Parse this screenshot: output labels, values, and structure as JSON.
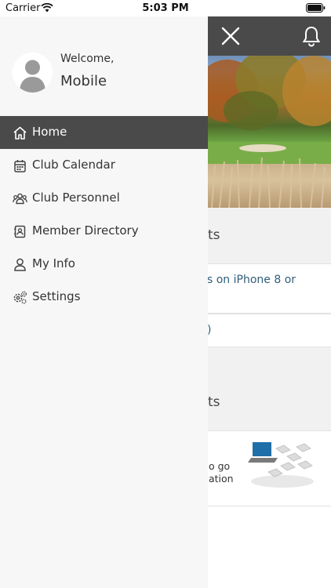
{
  "status_bar": {
    "carrier": "Carrier",
    "time": "5:03 PM"
  },
  "header": {
    "background_color": "#4a4a4a",
    "close_icon": "close-icon",
    "bell_icon": "bell-icon"
  },
  "content": {
    "section1_title": "ts",
    "link1_line1": "s on iPhone 8 or",
    "link2": ")",
    "section2_title": "ts",
    "news_line1": "o go",
    "news_line2": "ation"
  },
  "drawer": {
    "welcome": "Welcome,",
    "user_name": "Mobile",
    "menu": [
      {
        "label": "Home",
        "icon": "home-icon",
        "active": true
      },
      {
        "label": "Club Calendar",
        "icon": "calendar-icon",
        "active": false
      },
      {
        "label": "Club Personnel",
        "icon": "people-icon",
        "active": false
      },
      {
        "label": "Member Directory",
        "icon": "directory-icon",
        "active": false
      },
      {
        "label": "My Info",
        "icon": "person-icon",
        "active": false
      },
      {
        "label": "Settings",
        "icon": "settings-icon",
        "active": false
      }
    ]
  },
  "colors": {
    "active_menu_bg": "#4a4a4a",
    "drawer_bg": "#f7f7f7",
    "link_color": "#2f5f78"
  }
}
